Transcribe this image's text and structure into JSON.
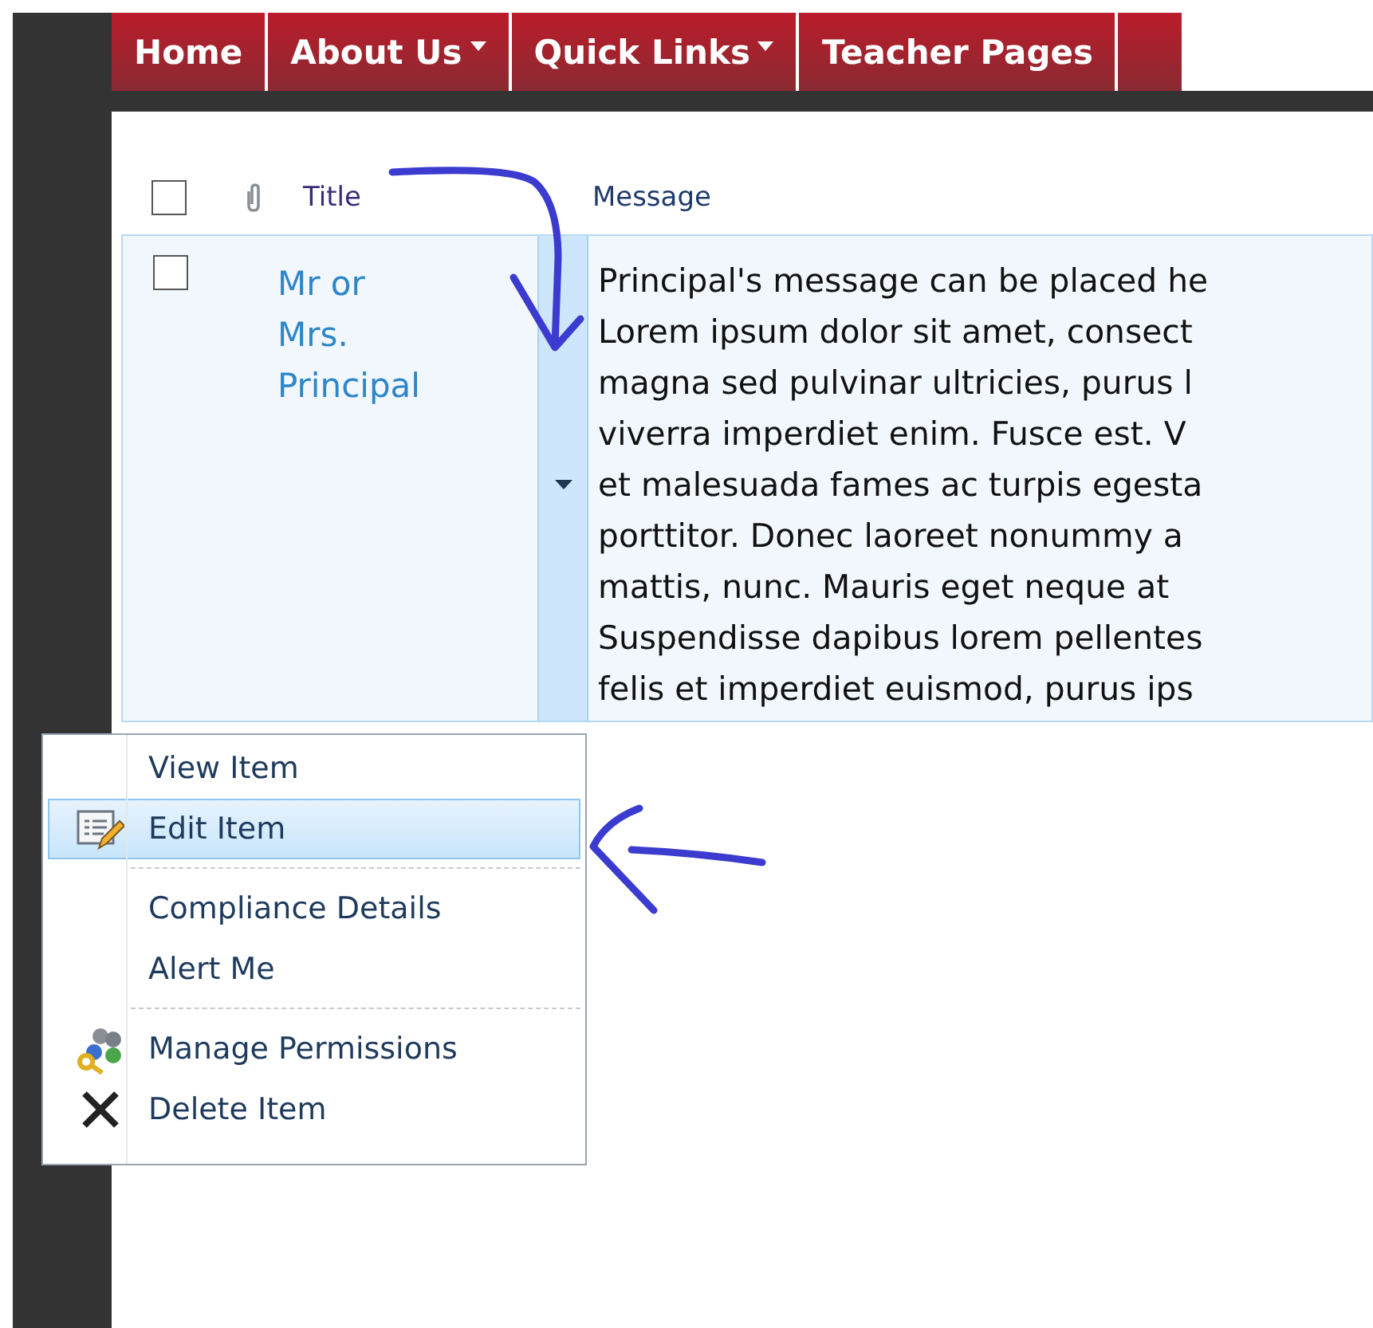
{
  "nav": {
    "tabs": [
      {
        "label": "Home",
        "has_dropdown": false
      },
      {
        "label": "About Us",
        "has_dropdown": true
      },
      {
        "label": "Quick Links",
        "has_dropdown": true
      },
      {
        "label": "Teacher Pages",
        "has_dropdown": false
      },
      {
        "has_dropdown": false
      }
    ]
  },
  "list": {
    "columns": [
      "Title",
      "Message"
    ],
    "header_checked": false,
    "rows": [
      {
        "checked": false,
        "title_lines": [
          "Mr or",
          "Mrs.",
          "Principal"
        ],
        "message_lines": [
          "Principal's message can be placed he",
          "Lorem ipsum dolor sit amet, consect",
          "magna sed pulvinar ultricies, purus l",
          "viverra imperdiet enim. Fusce est. V",
          "et malesuada fames ac turpis egesta",
          "porttitor. Donec laoreet nonummy a",
          "mattis, nunc. Mauris eget neque at",
          "Suspendisse dapibus lorem pellentes",
          "felis et imperdiet euismod, purus ips"
        ]
      }
    ]
  },
  "context_menu": {
    "items": [
      {
        "label": "View Item",
        "selected": false,
        "separator_after": false
      },
      {
        "label": "Edit Item",
        "selected": true,
        "separator_after": true
      },
      {
        "label": "Compliance Details",
        "selected": false,
        "separator_after": false
      },
      {
        "label": "Alert Me",
        "selected": false,
        "separator_after": true
      },
      {
        "label": "Manage Permissions",
        "selected": false,
        "separator_after": false
      },
      {
        "label": "Delete Item",
        "selected": false,
        "separator_after": false
      }
    ]
  }
}
